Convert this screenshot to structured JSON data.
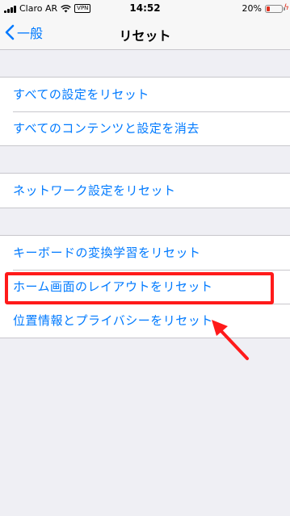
{
  "status_bar": {
    "carrier": "Claro AR",
    "vpn_label": "VPN",
    "time": "14:52",
    "battery_percent": "20%",
    "battery_level": 0.2
  },
  "nav": {
    "back_label": "一般",
    "title": "リセット"
  },
  "groups": [
    {
      "items": [
        "すべての設定をリセット",
        "すべてのコンテンツと設定を消去"
      ]
    },
    {
      "items": [
        "ネットワーク設定をリセット"
      ]
    },
    {
      "items": [
        "キーボードの変換学習をリセット",
        "ホーム画面のレイアウトをリセット",
        "位置情報とプライバシーをリセット"
      ]
    }
  ],
  "annotation": {
    "highlight_color": "#ff1a1a",
    "highlighted_item": "ホーム画面のレイアウトをリセット"
  },
  "colors": {
    "accent": "#007aff",
    "background": "#efeff4",
    "separator": "#c8c7cc"
  }
}
